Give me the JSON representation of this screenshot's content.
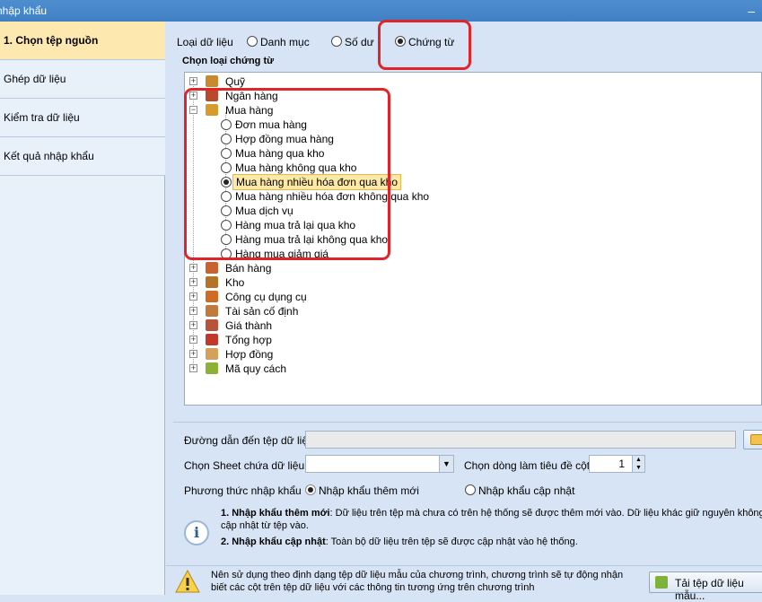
{
  "window": {
    "title": "nhập khẩu",
    "minimize": "–"
  },
  "sidebar": {
    "items": [
      {
        "label": "1. Chọn tệp nguồn"
      },
      {
        "label": "Ghép dữ liệu"
      },
      {
        "label": "Kiểm tra dữ liệu"
      },
      {
        "label": "Kết quả nhập khẩu"
      }
    ]
  },
  "data_type": {
    "label": "Loại dữ liệu",
    "options": [
      {
        "label": "Danh mục",
        "selected": false
      },
      {
        "label": "Số dư",
        "selected": false
      },
      {
        "label": "Chứng từ",
        "selected": true
      }
    ]
  },
  "tree": {
    "group_title": "Chọn loại chứng từ",
    "nodes": [
      {
        "label": "Quỹ",
        "icon": "cash-icon",
        "expanded": false
      },
      {
        "label": "Ngân hàng",
        "icon": "bank-icon",
        "expanded": false
      },
      {
        "label": "Mua hàng",
        "icon": "purchase-icon",
        "expanded": true
      },
      {
        "label": "Bán hàng",
        "icon": "sales-icon",
        "expanded": false
      },
      {
        "label": "Kho",
        "icon": "warehouse-icon",
        "expanded": false
      },
      {
        "label": "Công cụ dụng cụ",
        "icon": "tools-icon",
        "expanded": false
      },
      {
        "label": "Tài sản cố định",
        "icon": "asset-icon",
        "expanded": false
      },
      {
        "label": "Giá thành",
        "icon": "cost-icon",
        "expanded": false
      },
      {
        "label": "Tổng hợp",
        "icon": "summary-icon",
        "expanded": false
      },
      {
        "label": "Hợp đồng",
        "icon": "contract-icon",
        "expanded": false
      },
      {
        "label": "Mã quy cách",
        "icon": "spec-icon",
        "expanded": false
      }
    ],
    "purchase_children": [
      {
        "label": "Đơn mua hàng",
        "selected": false
      },
      {
        "label": "Hợp đồng mua hàng",
        "selected": false
      },
      {
        "label": "Mua hàng qua kho",
        "selected": false
      },
      {
        "label": "Mua hàng không qua kho",
        "selected": false
      },
      {
        "label": "Mua hàng nhiều hóa đơn qua kho",
        "selected": true
      },
      {
        "label": "Mua hàng nhiều hóa đơn không qua kho",
        "selected": false
      },
      {
        "label": "Mua dịch vụ",
        "selected": false
      },
      {
        "label": "Hàng mua trả lại qua kho",
        "selected": false
      },
      {
        "label": "Hàng mua trả lại không qua kho",
        "selected": false
      },
      {
        "label": "Hàng mua giảm giá",
        "selected": false
      }
    ]
  },
  "form": {
    "path_label": "Đường dẫn đến tệp dữ liệu",
    "path_value": "",
    "sheet_label": "Chọn Sheet chứa dữ liệu",
    "sheet_value": "",
    "header_row_label": "Chọn dòng làm tiêu đề cột",
    "header_row_value": "1",
    "method_label": "Phương thức nhập khẩu",
    "method_options": [
      {
        "label": "Nhập khẩu thêm mới",
        "selected": true
      },
      {
        "label": "Nhập khẩu cập nhật",
        "selected": false
      }
    ]
  },
  "info": {
    "line1_bold": "1. Nhập khẩu thêm mới",
    "line1_text": ": Dữ liệu trên tệp mà chưa có trên hệ thống sẽ được thêm mới vào. Dữ liệu khác giữ nguyên không",
    "line1_cont": "cập nhật từ tệp vào.",
    "line2_bold": "2. Nhập khẩu cập nhật",
    "line2_text": ": Toàn bộ dữ liệu trên tệp sẽ được cập nhật vào hệ thống."
  },
  "warning": {
    "line1": "Nên sử dụng theo định dạng tệp dữ liệu mẫu của chương trình, chương trình sẽ tự động nhận",
    "line2": "biết các cột trên tệp dữ liệu với các thông tin tương ứng trên chương trình",
    "download_label": "Tải tệp dữ liệu mẫu..."
  }
}
